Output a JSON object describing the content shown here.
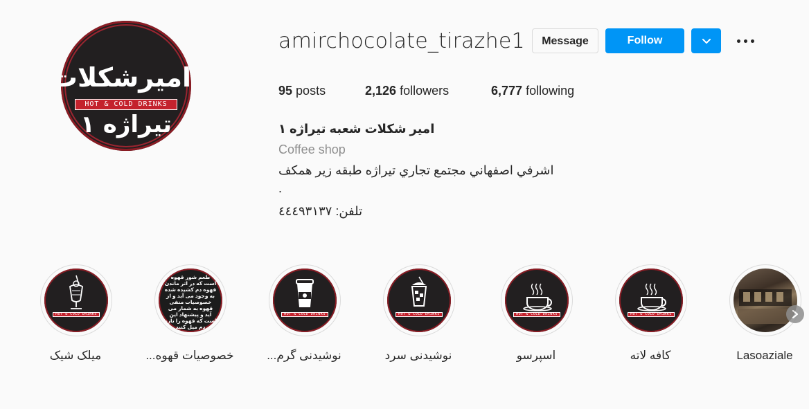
{
  "profile": {
    "username": "amirchocolate_tirazhe1",
    "avatar": {
      "brand_top": "امیرشکلات",
      "tagline": "HOT & COLD DRINKS",
      "brand_bottom": "تیراژه ۱"
    },
    "buttons": {
      "message": "Message",
      "follow": "Follow"
    },
    "icons": {
      "dropdown": "chevron-down-icon",
      "more": "more-options-icon"
    },
    "accent_color": "#0095f6"
  },
  "stats": {
    "posts_count": "95",
    "posts_label": "posts",
    "followers_count": "2,126",
    "followers_label": "followers",
    "following_count": "6,777",
    "following_label": "following"
  },
  "bio": {
    "name": "امیر شکلات شعبه تیراژه ١",
    "category": "Coffee shop",
    "address": "اشرفي اصفهاني مجتمع تجاري تيراژه طبقه زير همكف",
    "dot": ".",
    "phone": "تلفن: ٤٤٤٩٣١٣٧"
  },
  "highlights": [
    {
      "label": "Lasoaziale",
      "cover": "photo"
    },
    {
      "label": "کافه لاته",
      "cover": "coffee-cup-icon",
      "strip": "HOT & COLD DRINKS"
    },
    {
      "label": "اسپرسو",
      "cover": "coffee-cup-icon",
      "strip": "HOT & COLD DRINKS"
    },
    {
      "label": "نوشیدنی سرد",
      "cover": "iced-drink-icon",
      "strip": "HOT & COLD DRINKS"
    },
    {
      "label": "نوشیدنی گرم...",
      "cover": "takeaway-cup-icon",
      "strip": "HOT & COLD DRINKS"
    },
    {
      "label": "خصوصیات قهوه...",
      "cover": "text-card",
      "card_text": "طعم شور قهوه است که در اثر ماندن قهوه دم کشیده شده به وجود می آید و از خصوصیات منفی قهوه به شمار می آید و پیشنهاد این است که قهوه را تازه دم میل کنید"
    },
    {
      "label": "میلک شیک",
      "cover": "milkshake-glass-icon",
      "strip": "HOT & COLD DRINKS"
    }
  ]
}
